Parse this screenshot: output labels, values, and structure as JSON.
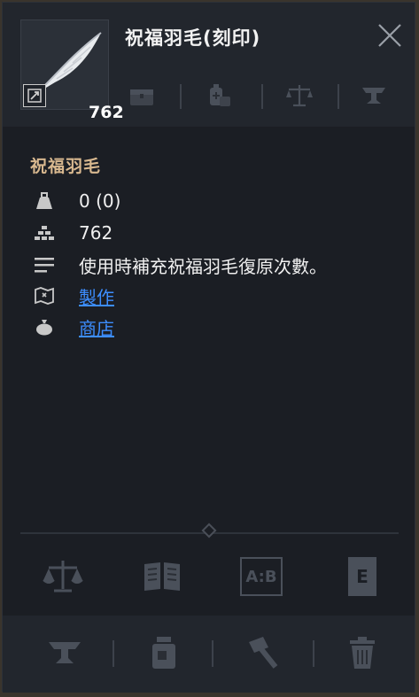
{
  "header": {
    "title": "祝福羽毛(刻印)",
    "count": "762",
    "icons": [
      "chest-icon",
      "potion-bag-icon",
      "scale-icon",
      "anvil-icon"
    ]
  },
  "info": {
    "name": "祝福羽毛",
    "weight": "0 (0)",
    "quantity": "762",
    "description": "使用時補充祝福羽毛復原次數。",
    "craft_link": "製作",
    "shop_link": "商店"
  },
  "tools": {
    "row1": [
      "scale-icon",
      "book-icon",
      "compare-ab-icon",
      "e-key-icon"
    ],
    "compare_label": "A:B",
    "e_label": "E",
    "row2": [
      "anvil-icon",
      "jar-icon",
      "hammer-icon",
      "trash-icon"
    ]
  },
  "colors": {
    "panel": "#1b1e24",
    "header": "#22262d",
    "name": "#d8b88f",
    "link": "#3d8eff",
    "icon_dim": "#4a505a"
  }
}
